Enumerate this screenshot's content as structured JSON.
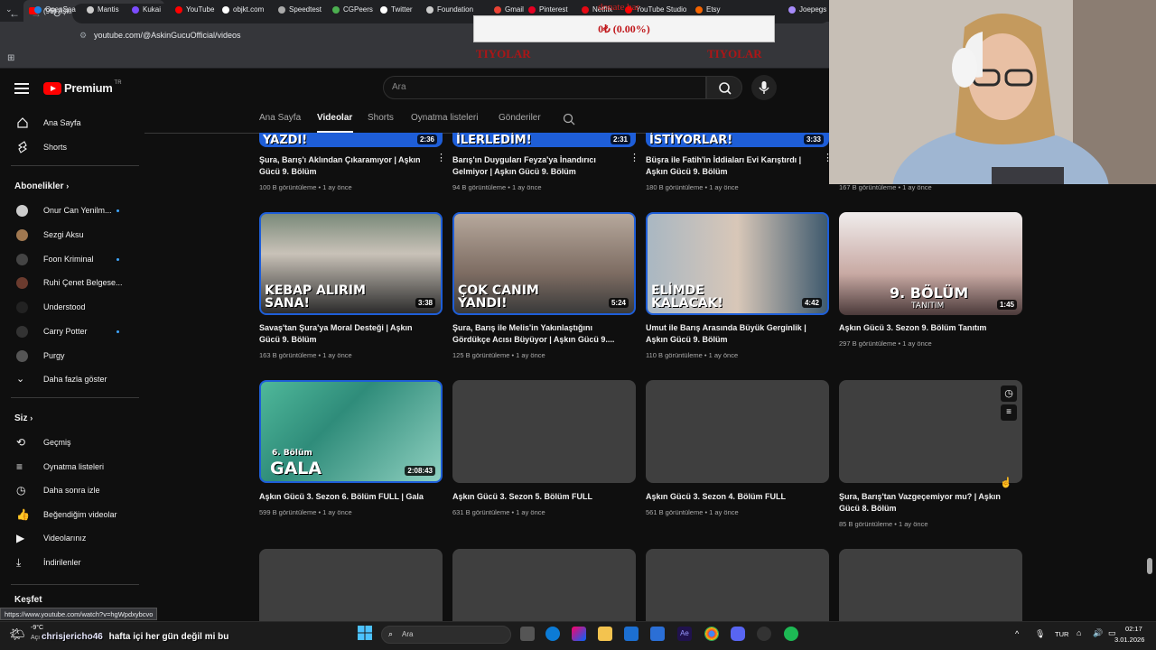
{
  "browser": {
    "tab_title": "(96) Aşkın Gücü Official - YouTube",
    "url": "youtube.com/@AskinGucuOfficial/videos",
    "status_url": "https://www.youtube.com/watch?v=hgWpdxybcvo",
    "bookmarks": [
      "OpenSea",
      "Mantis",
      "Kukai",
      "YouTube",
      "objkt.com",
      "Speedtest",
      "CGPeers",
      "Twitter",
      "Foundation",
      "Gmail",
      "Pinterest",
      "Netflix",
      "YouTube Studio",
      "Etsy",
      "Joepegs"
    ]
  },
  "overlay": {
    "donate_label": "donate bar",
    "donate_value": "0₺ (0.00%)",
    "red_left": "TIYOLAR",
    "red_right": "TIYOLAR"
  },
  "youtube": {
    "logo_text": "Premium",
    "logo_sup": "TR",
    "search_placeholder": "Ara"
  },
  "sidebar": {
    "home": "Ana Sayfa",
    "shorts": "Shorts",
    "subs_heading": "Abonelikler",
    "subs": [
      {
        "label": "Onur Can Yenilm...",
        "new": true
      },
      {
        "label": "Sezgi Aksu",
        "new": false
      },
      {
        "label": "Foon Kriminal",
        "new": true
      },
      {
        "label": "Ruhi Çenet Belgese...",
        "new": false
      },
      {
        "label": "Understood",
        "new": false
      },
      {
        "label": "Carry Potter",
        "new": true
      },
      {
        "label": "Purgy",
        "new": false
      }
    ],
    "show_more": "Daha fazla göster",
    "you_heading": "Siz",
    "you_items": [
      "Geçmiş",
      "Oynatma listeleri",
      "Daha sonra izle",
      "Beğendiğim videolar",
      "Videolarınız",
      "İndirilenler"
    ],
    "explore_heading": "Keşfet"
  },
  "channel_tabs": [
    "Ana Sayfa",
    "Videolar",
    "Shorts",
    "Oynatma listeleri",
    "Gönderiler"
  ],
  "videos_row0": [
    {
      "overlay": "YAZDI!",
      "duration": "2:36",
      "title": "Şura, Barış'ı Aklından Çıkaramıyor | Aşkın Gücü 9. Bölüm",
      "meta": "100 B görüntüleme • 1 ay önce"
    },
    {
      "overlay": "İLERLEDİM!",
      "duration": "2:31",
      "title": "Barış'ın Duyguları Feyza'ya İnandırıcı Gelmiyor | Aşkın Gücü 9. Bölüm",
      "meta": "94 B görüntüleme • 1 ay önce"
    },
    {
      "overlay": "İSTİYORLAR!",
      "duration": "3:33",
      "title": "Büşra ile Fatih'in İddiaları Evi Karıştırdı | Aşkın Gücü 9. Bölüm",
      "meta": "180 B görüntüleme • 1 ay önce"
    },
    {
      "overlay": "",
      "duration": "",
      "title": "",
      "meta": "167 B görüntüleme • 1 ay önce"
    }
  ],
  "videos_row1": [
    {
      "overlay": "KEBAP ALIRIM SANA!",
      "duration": "3:38",
      "title": "Savaş'tan Şura'ya Moral Desteği | Aşkın Gücü 9. Bölüm",
      "meta": "163 B görüntüleme • 1 ay önce"
    },
    {
      "overlay": "ÇOK CANIM YANDI!",
      "duration": "5:24",
      "title": "Şura, Barış ile Melis'in Yakınlaştığını Gördükçe Acısı Büyüyor | Aşkın Gücü 9....",
      "meta": "125 B görüntüleme • 1 ay önce"
    },
    {
      "overlay": "ELİMDE KALACAK!",
      "duration": "4:42",
      "title": "Umut ile Barış Arasında Büyük Gerginlik | Aşkın Gücü 9. Bölüm",
      "meta": "110 B görüntüleme • 1 ay önce"
    },
    {
      "overlay": "9. BÖLÜM",
      "overlay_sub": "TANITIM",
      "duration": "1:45",
      "title": "Aşkın Gücü 3. Sezon 9. Bölüm Tanıtım",
      "meta": "297 B görüntüleme • 1 ay önce"
    }
  ],
  "videos_row2": [
    {
      "overlay": "GALA",
      "overlay_sub": "6. Bölüm",
      "duration": "2:08:43",
      "title": "Aşkın Gücü 3. Sezon 6. Bölüm FULL | Gala",
      "meta": "599 B görüntüleme • 1 ay önce"
    },
    {
      "title": "Aşkın Gücü 3. Sezon 5. Bölüm FULL",
      "meta": "631 B görüntüleme • 1 ay önce"
    },
    {
      "title": "Aşkın Gücü 3. Sezon 4. Bölüm FULL",
      "meta": "561 B görüntüleme • 1 ay önce"
    },
    {
      "title": "Şura, Barış'tan Vazgeçemiyor mu? | Aşkın Gücü 8. Bölüm",
      "meta": "85 B görüntüleme • 1 ay önce"
    }
  ],
  "taskbar": {
    "weather": "-9°C",
    "weather_sub": "Açı",
    "chat_user": "chrisjericho46",
    "chat_msg": "hafta içi her gün değil mi bu",
    "search": "Ara",
    "lang": "TUR",
    "time": "02:17",
    "date": "3.01.2026"
  },
  "colors": {
    "bg": "#0f0f0f",
    "accent": "#ff0000",
    "link": "#3ea6ff"
  }
}
